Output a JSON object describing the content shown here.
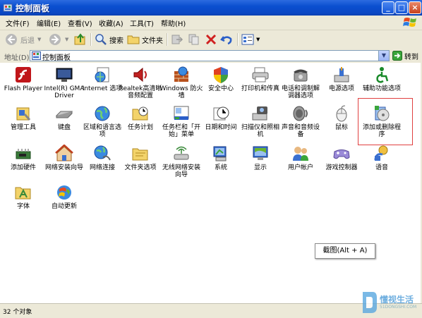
{
  "window": {
    "title": "控制面板"
  },
  "menu": [
    "文件(F)",
    "编辑(E)",
    "查看(V)",
    "收藏(A)",
    "工具(T)",
    "帮助(H)"
  ],
  "toolbar": {
    "back": "后退",
    "search": "搜索",
    "folders": "文件夹"
  },
  "address": {
    "label": "地址(D)",
    "value": "控制面板",
    "go": "转到"
  },
  "items": [
    {
      "label": "Flash Player",
      "icon": "flash-icon"
    },
    {
      "label": "Intel(R) GMA Driver",
      "icon": "intel-gma-icon"
    },
    {
      "label": "Internet 选项",
      "icon": "internet-options-icon"
    },
    {
      "label": "Realtek高清晰音频配置",
      "icon": "realtek-audio-icon"
    },
    {
      "label": "Windows 防火墙",
      "icon": "firewall-icon"
    },
    {
      "label": "安全中心",
      "icon": "shield-icon"
    },
    {
      "label": "打印机和传真",
      "icon": "printer-icon"
    },
    {
      "label": "电话和调制解调器选项",
      "icon": "phone-modem-icon"
    },
    {
      "label": "电源选项",
      "icon": "power-options-icon"
    },
    {
      "label": "辅助功能选项",
      "icon": "accessibility-icon"
    },
    {
      "label": "管理工具",
      "icon": "admin-tools-icon"
    },
    {
      "label": "键盘",
      "icon": "keyboard-icon"
    },
    {
      "label": "区域和语言选项",
      "icon": "globe-icon"
    },
    {
      "label": "任务计划",
      "icon": "scheduled-tasks-icon"
    },
    {
      "label": "任务栏和「开始」菜单",
      "icon": "taskbar-icon"
    },
    {
      "label": "日期和时间",
      "icon": "clock-icon"
    },
    {
      "label": "扫描仪和照相机",
      "icon": "scanner-camera-icon"
    },
    {
      "label": "声音和音频设备",
      "icon": "speaker-icon"
    },
    {
      "label": "鼠标",
      "icon": "mouse-icon"
    },
    {
      "label": "添加或删除程序",
      "icon": "add-remove-programs-icon"
    },
    {
      "label": "添加硬件",
      "icon": "add-hardware-icon"
    },
    {
      "label": "网络安装向导",
      "icon": "network-setup-icon"
    },
    {
      "label": "网络连接",
      "icon": "network-connections-icon"
    },
    {
      "label": "文件夹选项",
      "icon": "folder-options-icon"
    },
    {
      "label": "无线网络安装向导",
      "icon": "wireless-setup-icon"
    },
    {
      "label": "系统",
      "icon": "system-icon"
    },
    {
      "label": "显示",
      "icon": "display-icon"
    },
    {
      "label": "用户帐户",
      "icon": "user-accounts-icon"
    },
    {
      "label": "游戏控制器",
      "icon": "game-controller-icon"
    },
    {
      "label": "语音",
      "icon": "speech-icon"
    },
    {
      "label": "字体",
      "icon": "fonts-icon"
    },
    {
      "label": "自动更新",
      "icon": "auto-update-icon"
    }
  ],
  "tooltip": "截图(Alt + A)",
  "status": "32 个对象",
  "watermark": {
    "name": "懂视生活",
    "url": "51DONGSHI.COM"
  }
}
